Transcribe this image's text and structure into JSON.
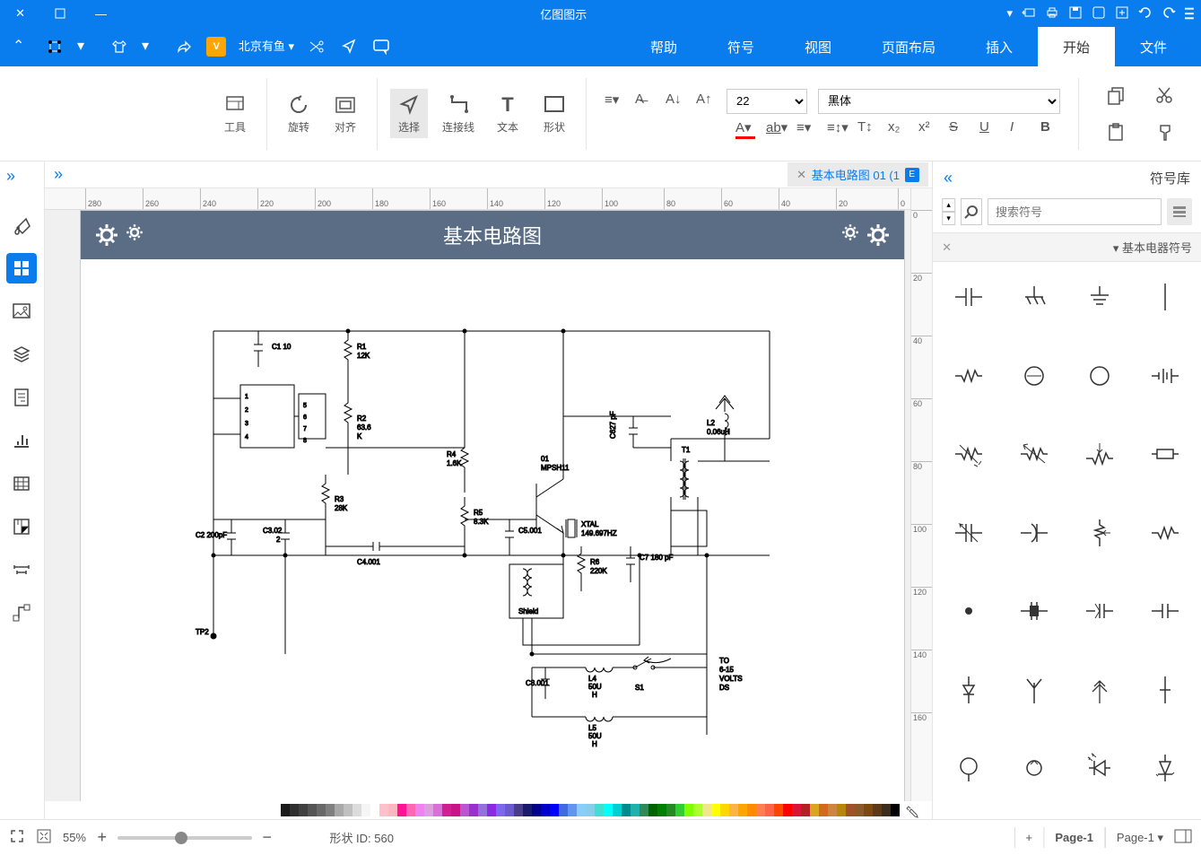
{
  "title": "亿图图示",
  "menu": {
    "file": "文件",
    "start": "开始",
    "insert": "插入",
    "layout": "页面布局",
    "view": "视图",
    "symbols": "符号",
    "help": "帮助"
  },
  "ribbon": {
    "font_name": "黑体",
    "font_size": "22",
    "select": "选择",
    "connect": "连接线",
    "text": "文本",
    "shape": "形状",
    "align": "对齐",
    "rotate": "旋转",
    "tools": "工具"
  },
  "sidebar": {
    "title": "符号库",
    "search_placeholder": "搜索符号",
    "group": "基本电器符号"
  },
  "doc_tab": {
    "label": "基本电路图 01 (1",
    "icon": "E"
  },
  "banner_title": "基本电路图",
  "hruler_ticks": [
    "0",
    "20",
    "40",
    "60",
    "80",
    "100",
    "120",
    "140",
    "160",
    "180",
    "200",
    "220",
    "240",
    "260",
    "280"
  ],
  "vruler_ticks": [
    "0",
    "20",
    "40",
    "60",
    "80",
    "100",
    "120",
    "140",
    "160"
  ],
  "components": {
    "r1": "R1\n12K",
    "c1": "C1 10",
    "r2": "R2\n63.6\nK",
    "r3": "R3\n28K",
    "r4": "R4\n1.6K",
    "r5": "R5\n8.3K",
    "q1": "01\nMPSH11",
    "xtal": "XTAL\n149.697HZ",
    "r6": "R6\n220K",
    "c027": "C627 pF",
    "c7": "C7 180 pF",
    "l2": "L2\n0.06uH",
    "t1": "T1",
    "shield": "Shield",
    "c2": "C2 200pF",
    "c3": "C3.02\n2",
    "c4": "C4.001",
    "c5": "C5.001",
    "tp2": "TP2",
    "note": "TO\n6-15\nVOLTS\nDS",
    "l4": "L4\n50U\nH",
    "l5": "L5\n50U\nH",
    "c8": "C8.001",
    "s1": "S1",
    "ic1": "1\n2",
    "ic2": "3\n4",
    "ic3": "5\n6",
    "ic4": "7\n8"
  },
  "status": {
    "page_dropdown": "Page-1",
    "page_tab": "Page-1",
    "plus": "+",
    "shape_id_label": "形状 ID:",
    "shape_id_value": "560",
    "zoom_pct": "55%"
  }
}
